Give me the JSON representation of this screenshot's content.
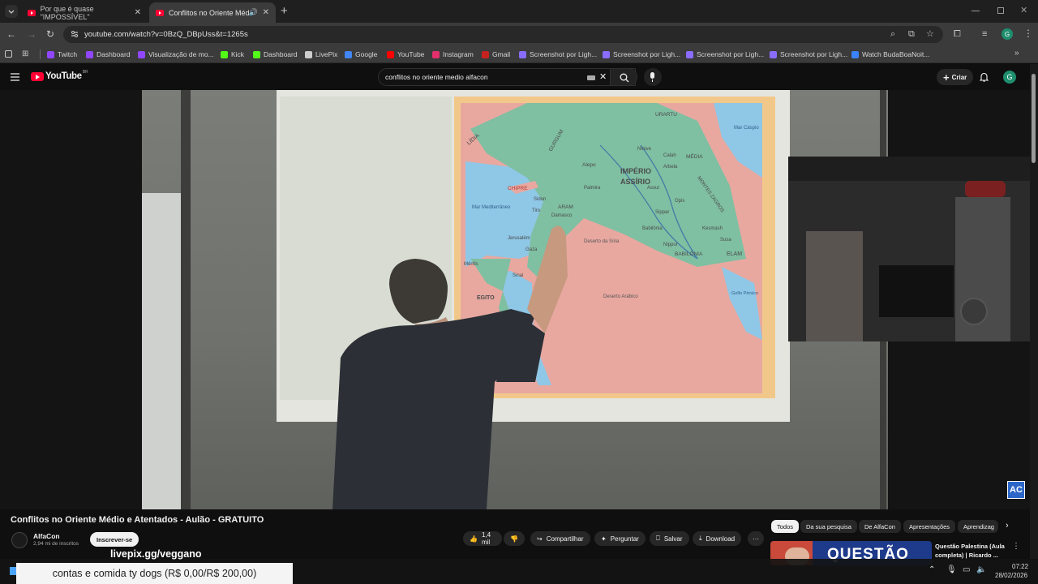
{
  "browser": {
    "tabs": [
      {
        "title": "Por que é quase \"IMPOSSÍVEL\""
      },
      {
        "title": "Conflitos no Oriente Médio"
      }
    ],
    "url": "youtube.com/watch?v=0BzQ_DBpUss&t=1265s",
    "profile_initial": "G",
    "bookmarks": [
      {
        "label": "Twitch",
        "color": "#9146ff"
      },
      {
        "label": "Dashboard",
        "color": "#9146ff"
      },
      {
        "label": "Visualização de mo...",
        "color": "#9146ff"
      },
      {
        "label": "Kick",
        "color": "#53fc18"
      },
      {
        "label": "Dashboard",
        "color": "#53fc18"
      },
      {
        "label": "LivePix",
        "color": "#cccccc"
      },
      {
        "label": "Google",
        "color": "#4285f4"
      },
      {
        "label": "YouTube",
        "color": "#ff0000"
      },
      {
        "label": "Instagram",
        "color": "#e1306c"
      },
      {
        "label": "Gmail",
        "color": "#c5221f"
      },
      {
        "label": "Screenshot por Ligh...",
        "color": "#8a6cff"
      },
      {
        "label": "Screenshot por Ligh...",
        "color": "#8a6cff"
      },
      {
        "label": "Screenshot por Ligh...",
        "color": "#8a6cff"
      },
      {
        "label": "Screenshot por Ligh...",
        "color": "#8a6cff"
      },
      {
        "label": "Watch BudaBoaNoit...",
        "color": "#3b82f6"
      }
    ]
  },
  "youtube": {
    "logo": "YouTube",
    "logo_suffix": "BR",
    "search_value": "conflitos no oriente medio alfacon",
    "create_label": "Criar",
    "avatar_initial": "G"
  },
  "video": {
    "map_labels": {
      "lidia": "LÍDIA",
      "gurgum": "GURGUM",
      "urartu": "URARTU",
      "mar_caspio": "Mar Cáspio",
      "chipre": "CHIPRE",
      "alepo": "Alepo",
      "imperio": "IMPÉRIO",
      "assirio": "ASSÍRIO",
      "nivive": "Nínive",
      "calah": "Calah",
      "media": "MÉDIA",
      "assur": "Assur",
      "arbela": "Arbela",
      "sidon": "Sidon",
      "palmira": "Palmira",
      "mar_med": "Mar Mediterrâneo",
      "aram": "ARAM",
      "damasco": "Damasco",
      "tiro": "Tiro",
      "opis": "Opis",
      "sippar": "Sippar",
      "jerusalem": "Jerusalém",
      "gaza": "Gaza",
      "deserto_siria": "Deserto da Síria",
      "babilonia_city": "Babilônia",
      "kesmash": "Kesmash",
      "susa": "Susa",
      "nippur": "Nippur",
      "babilonia": "BABILÔNIA",
      "elam": "ELAM",
      "menfis": "Mênfis",
      "sinai": "Sinai",
      "egito": "EGITO",
      "deserto_arabico": "Deserto Arábico",
      "golfo": "Golfo Pérsico",
      "montes": "MONTES ZAGROS"
    },
    "watermark": "AC"
  },
  "details": {
    "title": "Conflitos no Oriente Médio e Atentados - Aulão - GRATUITO",
    "channel": "AlfaCon",
    "subscribers": "2,94 mi de inscritos",
    "subscribe_label": "Inscrever-se",
    "likes": "1,4 mil",
    "share_label": "Compartilhar",
    "ask_label": "Perguntar",
    "save_label": "Salvar",
    "download_label": "Download"
  },
  "sidebar": {
    "chips": [
      "Todos",
      "Da sua pesquisa",
      "De AlfaCon",
      "Apresentações",
      "Aprendizag"
    ],
    "next_video_title": "Questão Palestina (Aula completa) | Ricardo ...",
    "next_thumb_text": "QUESTÃO"
  },
  "overlay": {
    "livepix": "livepix.gg/veggano",
    "donation": "contas e comida ty dogs (R$ 0,00/R$ 200,00)"
  },
  "system": {
    "time": "07:22",
    "date": "28/02/2026"
  }
}
